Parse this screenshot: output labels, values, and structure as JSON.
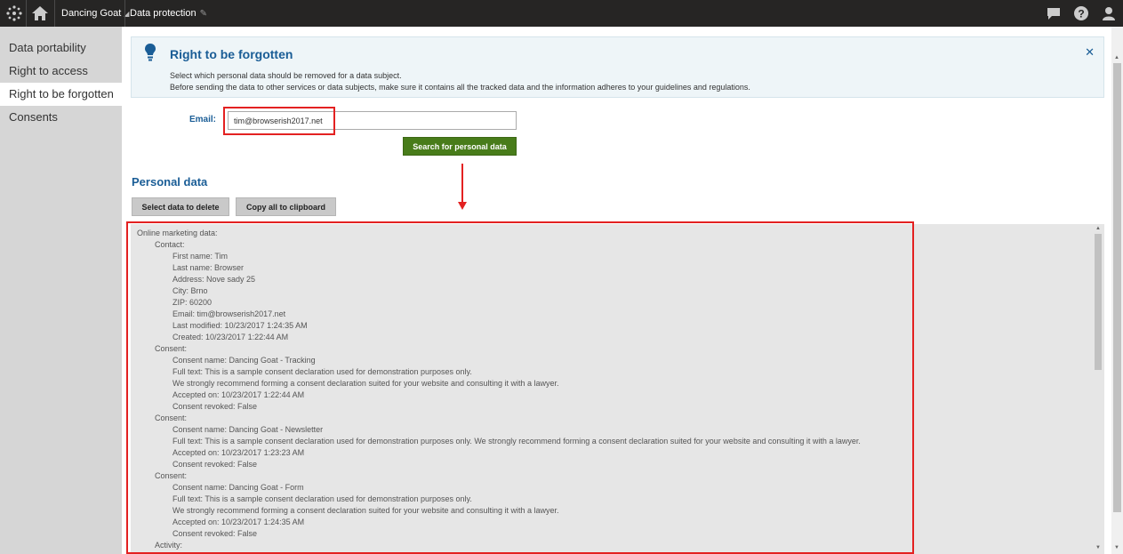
{
  "header": {
    "site_name": "Dancing Goat",
    "app_name": "Data protection"
  },
  "sidebar": {
    "items": [
      {
        "label": "Data portability"
      },
      {
        "label": "Right to access"
      },
      {
        "label": "Right to be forgotten"
      },
      {
        "label": "Consents"
      }
    ],
    "active": "Right to be forgotten"
  },
  "info": {
    "title": "Right to be forgotten",
    "line1": "Select which personal data should be removed for a data subject.",
    "line2": "Before sending the data to other services or data subjects, make sure it contains all the tracked data and the information adheres to your guidelines and regulations."
  },
  "form": {
    "email_label": "Email:",
    "email_value": "tim@browserish2017.net",
    "search_button": "Search for personal data"
  },
  "personal_data": {
    "title": "Personal data",
    "select_button": "Select data to delete",
    "copy_button": "Copy all to clipboard",
    "lines": [
      {
        "indent": 0,
        "text": "Online marketing data:"
      },
      {
        "indent": 1,
        "text": "Contact:"
      },
      {
        "indent": 2,
        "text": "First name: Tim"
      },
      {
        "indent": 2,
        "text": "Last name: Browser"
      },
      {
        "indent": 2,
        "text": "Address: Nove sady 25"
      },
      {
        "indent": 2,
        "text": "City: Brno"
      },
      {
        "indent": 2,
        "text": "ZIP: 60200"
      },
      {
        "indent": 2,
        "text": "Email: tim@browserish2017.net"
      },
      {
        "indent": 2,
        "text": "Last modified: 10/23/2017 1:24:35 AM"
      },
      {
        "indent": 2,
        "text": "Created: 10/23/2017 1:22:44 AM"
      },
      {
        "indent": 1,
        "text": "Consent:"
      },
      {
        "indent": 2,
        "text": "Consent name: Dancing Goat - Tracking"
      },
      {
        "indent": 2,
        "text": "Full text: This is a sample consent declaration used for demonstration purposes only."
      },
      {
        "indent": 2,
        "text": "We strongly recommend forming a consent declaration suited for your website and consulting it with a lawyer."
      },
      {
        "indent": 2,
        "text": "Accepted on: 10/23/2017 1:22:44 AM"
      },
      {
        "indent": 2,
        "text": "Consent revoked: False"
      },
      {
        "indent": 1,
        "text": "Consent:"
      },
      {
        "indent": 2,
        "text": "Consent name: Dancing Goat - Newsletter"
      },
      {
        "indent": 2,
        "text": "Full text: This is a sample consent declaration used for demonstration purposes only. We strongly recommend forming a consent declaration suited for your website and consulting it with a lawyer."
      },
      {
        "indent": 2,
        "text": "Accepted on: 10/23/2017 1:23:23 AM"
      },
      {
        "indent": 2,
        "text": "Consent revoked: False"
      },
      {
        "indent": 1,
        "text": "Consent:"
      },
      {
        "indent": 2,
        "text": "Consent name: Dancing Goat - Form"
      },
      {
        "indent": 2,
        "text": "Full text: This is a sample consent declaration used for demonstration purposes only."
      },
      {
        "indent": 2,
        "text": "We strongly recommend forming a consent declaration suited for your website and consulting it with a lawyer."
      },
      {
        "indent": 2,
        "text": "Accepted on: 10/23/2017 1:24:35 AM"
      },
      {
        "indent": 2,
        "text": "Consent revoked: False"
      },
      {
        "indent": 1,
        "text": "Activity:"
      }
    ]
  },
  "icons": {
    "logo": "kentico-logo-icon",
    "home": "home-icon",
    "pin": "pin-icon",
    "chat": "chat-icon",
    "help": "help-icon",
    "user": "user-icon",
    "bulb": "lightbulb-icon",
    "close": "close-icon"
  },
  "colors": {
    "accent_blue": "#1a5d96",
    "topbar": "#262524",
    "search_button": "#487c1a",
    "highlight": "#e32121"
  }
}
